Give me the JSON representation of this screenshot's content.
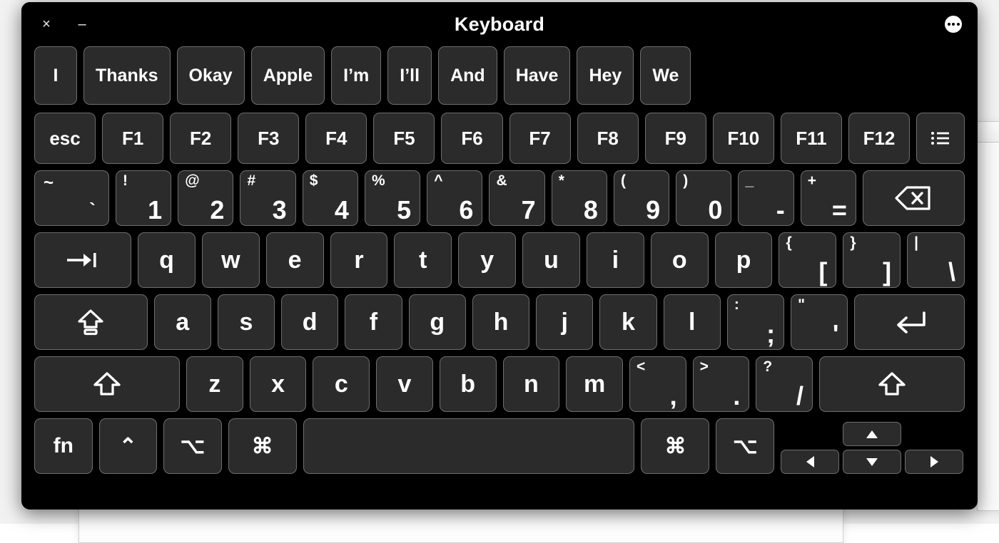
{
  "window": {
    "title": "Keyboard",
    "close_label": "×",
    "minimize_label": "–"
  },
  "suggestions": [
    {
      "label": "I"
    },
    {
      "label": "Thanks"
    },
    {
      "label": "Okay"
    },
    {
      "label": "Apple"
    },
    {
      "label": "I’m"
    },
    {
      "label": "I’ll"
    },
    {
      "label": "And"
    },
    {
      "label": "Have"
    },
    {
      "label": "Hey"
    },
    {
      "label": "We"
    }
  ],
  "function_row": [
    {
      "label": "esc",
      "name": "key-escape"
    },
    {
      "label": "F1",
      "name": "key-f1"
    },
    {
      "label": "F2",
      "name": "key-f2"
    },
    {
      "label": "F3",
      "name": "key-f3"
    },
    {
      "label": "F4",
      "name": "key-f4"
    },
    {
      "label": "F5",
      "name": "key-f5"
    },
    {
      "label": "F6",
      "name": "key-f6"
    },
    {
      "label": "F7",
      "name": "key-f7"
    },
    {
      "label": "F8",
      "name": "key-f8"
    },
    {
      "label": "F9",
      "name": "key-f9"
    },
    {
      "label": "F10",
      "name": "key-f10"
    },
    {
      "label": "F11",
      "name": "key-f11"
    },
    {
      "label": "F12",
      "name": "key-f12"
    }
  ],
  "panel_button": {
    "icon": "list-icon",
    "label": ""
  },
  "number_row": [
    {
      "top": "~",
      "bottom": "`",
      "name": "key-tilde-grave"
    },
    {
      "top": "!",
      "bottom": "1",
      "name": "key-1"
    },
    {
      "top": "@",
      "bottom": "2",
      "name": "key-2"
    },
    {
      "top": "#",
      "bottom": "3",
      "name": "key-3"
    },
    {
      "top": "$",
      "bottom": "4",
      "name": "key-4"
    },
    {
      "top": "%",
      "bottom": "5",
      "name": "key-5"
    },
    {
      "top": "^",
      "bottom": "6",
      "name": "key-6"
    },
    {
      "top": "&",
      "bottom": "7",
      "name": "key-7"
    },
    {
      "top": "*",
      "bottom": "8",
      "name": "key-8"
    },
    {
      "top": "(",
      "bottom": "9",
      "name": "key-9"
    },
    {
      "top": ")",
      "bottom": "0",
      "name": "key-0"
    },
    {
      "top": "_",
      "bottom": "-",
      "name": "key-minus"
    },
    {
      "top": "+",
      "bottom": "=",
      "name": "key-equals"
    }
  ],
  "delete_key": {
    "icon": "delete-icon",
    "label": ""
  },
  "tab_key": {
    "icon": "tab-icon",
    "label": ""
  },
  "qwerty_row": [
    {
      "label": "q",
      "name": "key-q"
    },
    {
      "label": "w",
      "name": "key-w"
    },
    {
      "label": "e",
      "name": "key-e"
    },
    {
      "label": "r",
      "name": "key-r"
    },
    {
      "label": "t",
      "name": "key-t"
    },
    {
      "label": "y",
      "name": "key-y"
    },
    {
      "label": "u",
      "name": "key-u"
    },
    {
      "label": "i",
      "name": "key-i"
    },
    {
      "label": "o",
      "name": "key-o"
    },
    {
      "label": "p",
      "name": "key-p"
    }
  ],
  "qwerty_symbols": [
    {
      "top": "{",
      "bottom": "[",
      "name": "key-bracket-left"
    },
    {
      "top": "}",
      "bottom": "]",
      "name": "key-bracket-right"
    },
    {
      "top": "|",
      "bottom": "\\",
      "name": "key-backslash"
    }
  ],
  "capslock_key": {
    "icon": "capslock-icon",
    "label": ""
  },
  "home_row": [
    {
      "label": "a",
      "name": "key-a"
    },
    {
      "label": "s",
      "name": "key-s"
    },
    {
      "label": "d",
      "name": "key-d"
    },
    {
      "label": "f",
      "name": "key-f"
    },
    {
      "label": "g",
      "name": "key-g"
    },
    {
      "label": "h",
      "name": "key-h"
    },
    {
      "label": "j",
      "name": "key-j"
    },
    {
      "label": "k",
      "name": "key-k"
    },
    {
      "label": "l",
      "name": "key-l"
    }
  ],
  "home_symbols": [
    {
      "top": ":",
      "bottom": ";",
      "name": "key-semicolon"
    },
    {
      "top": "\"",
      "bottom": "'",
      "name": "key-quote"
    }
  ],
  "return_key": {
    "icon": "return-icon",
    "label": ""
  },
  "shift_left_key": {
    "icon": "shift-icon",
    "label": ""
  },
  "shift_right_key": {
    "icon": "shift-icon",
    "label": ""
  },
  "bottom_row_letters": [
    {
      "label": "z",
      "name": "key-z"
    },
    {
      "label": "x",
      "name": "key-x"
    },
    {
      "label": "c",
      "name": "key-c"
    },
    {
      "label": "v",
      "name": "key-v"
    },
    {
      "label": "b",
      "name": "key-b"
    },
    {
      "label": "n",
      "name": "key-n"
    },
    {
      "label": "m",
      "name": "key-m"
    }
  ],
  "bottom_symbols": [
    {
      "top": "<",
      "bottom": ",",
      "name": "key-comma"
    },
    {
      "top": ">",
      "bottom": ".",
      "name": "key-period"
    },
    {
      "top": "?",
      "bottom": "/",
      "name": "key-slash"
    }
  ],
  "modifier_row": {
    "fn": "fn",
    "control": "⌃",
    "option_left": "⌥",
    "command_left": "⌘",
    "space": "",
    "command_right": "⌘",
    "option_right": "⌥"
  },
  "arrow_keys": {
    "up": "▲",
    "left": "◀",
    "down": "▼",
    "right": "▶"
  },
  "colors": {
    "window_background": "#000000",
    "key_face": "#2b2b2b",
    "key_border": "#6e6e6e",
    "key_text": "#ffffff",
    "accent_button": "#ffffff"
  }
}
